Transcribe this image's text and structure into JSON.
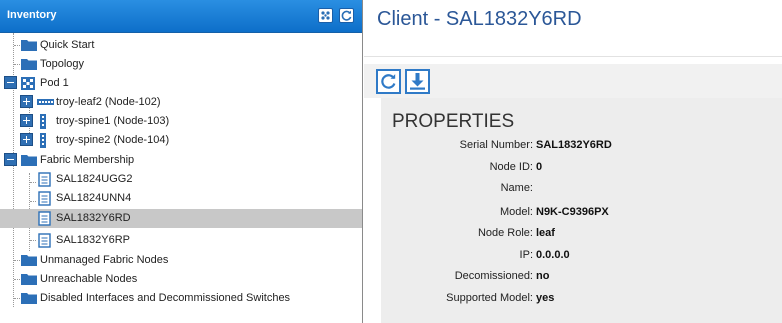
{
  "inventory": {
    "title": "Inventory",
    "items": [
      {
        "label": "Quick Start"
      },
      {
        "label": "Topology"
      },
      {
        "label": "Pod 1"
      },
      {
        "label": "troy-leaf2 (Node-102)"
      },
      {
        "label": "troy-spine1 (Node-103)"
      },
      {
        "label": "troy-spine2 (Node-104)"
      },
      {
        "label": "Fabric Membership"
      },
      {
        "label": "SAL1824UGG2"
      },
      {
        "label": "SAL1824UNN4"
      },
      {
        "label": "SAL1832Y6RD"
      },
      {
        "label": "SAL1832Y6RP"
      },
      {
        "label": "Unmanaged Fabric Nodes"
      },
      {
        "label": "Unreachable Nodes"
      },
      {
        "label": "Disabled Interfaces and Decommissioned Switches"
      }
    ],
    "selected": "SAL1832Y6RD"
  },
  "detail": {
    "title": "Client - SAL1832Y6RD",
    "properties_title": "PROPERTIES",
    "properties": [
      {
        "key": "Serial Number:",
        "value": "SAL1832Y6RD"
      },
      {
        "key": "Node ID:",
        "value": "0"
      },
      {
        "key": "Name:",
        "value": ""
      },
      {
        "key": "Model:",
        "value": "N9K-C9396PX"
      },
      {
        "key": "Node Role:",
        "value": "leaf"
      },
      {
        "key": "IP:",
        "value": "0.0.0.0"
      },
      {
        "key": "Decomissioned:",
        "value": "no"
      },
      {
        "key": "Supported Model:",
        "value": "yes"
      }
    ]
  },
  "colors": {
    "header_blue": "#0d6fc9",
    "title_blue": "#2b5797",
    "selected_row": "#c8c8c8",
    "folder_blue": "#2c6fb7"
  }
}
